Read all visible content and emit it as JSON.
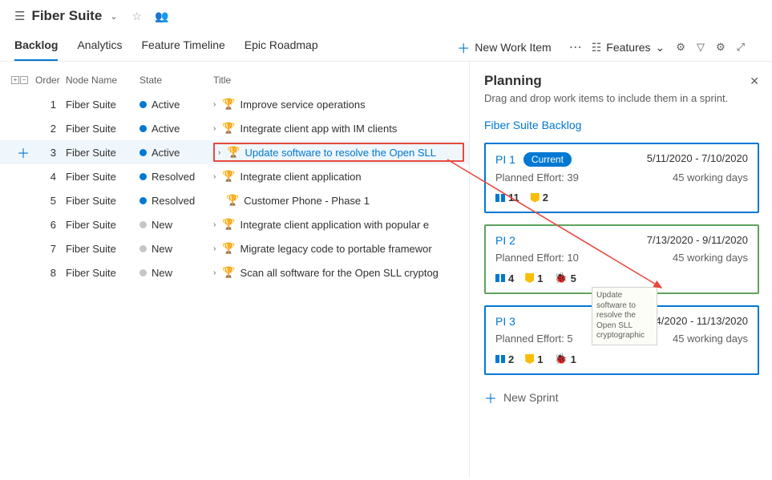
{
  "header": {
    "title": "Fiber Suite"
  },
  "tabs": [
    "Backlog",
    "Analytics",
    "Feature Timeline",
    "Epic Roadmap"
  ],
  "activeTab": 0,
  "newWorkItem": "New Work Item",
  "viewSelector": "Features",
  "grid": {
    "headers": {
      "order": "Order",
      "node": "Node Name",
      "state": "State",
      "title": "Title"
    },
    "rows": [
      {
        "order": "1",
        "node": "Fiber Suite",
        "state": "Active",
        "stateClass": "st-active",
        "title": "Improve service operations"
      },
      {
        "order": "2",
        "node": "Fiber Suite",
        "state": "Active",
        "stateClass": "st-active",
        "title": "Integrate client app with IM clients"
      },
      {
        "order": "3",
        "node": "Fiber Suite",
        "state": "Active",
        "stateClass": "st-active",
        "title": "Update software to resolve the Open SLL",
        "selected": true,
        "boxed": true
      },
      {
        "order": "4",
        "node": "Fiber Suite",
        "state": "Resolved",
        "stateClass": "st-resolved",
        "title": "Integrate client application"
      },
      {
        "order": "5",
        "node": "Fiber Suite",
        "state": "Resolved",
        "stateClass": "st-resolved",
        "title": "Customer Phone - Phase 1",
        "noChevron": true
      },
      {
        "order": "6",
        "node": "Fiber Suite",
        "state": "New",
        "stateClass": "st-new",
        "title": "Integrate client application with popular e"
      },
      {
        "order": "7",
        "node": "Fiber Suite",
        "state": "New",
        "stateClass": "st-new",
        "title": "Migrate legacy code to portable framewor"
      },
      {
        "order": "8",
        "node": "Fiber Suite",
        "state": "New",
        "stateClass": "st-new",
        "title": "Scan all software for the Open SLL cryptog"
      }
    ]
  },
  "panel": {
    "title": "Planning",
    "subtitle": "Drag and drop work items to include them in a sprint.",
    "backlogLink": "Fiber Suite Backlog",
    "sprints": [
      {
        "name": "PI 1",
        "current": true,
        "dates": "5/11/2020 - 7/10/2020",
        "effort": "Planned Effort: 39",
        "days": "45 working days",
        "counts": [
          {
            "icon": "book",
            "n": "11"
          },
          {
            "icon": "badge",
            "n": "2"
          }
        ]
      },
      {
        "name": "PI 2",
        "dates": "7/13/2020 - 9/11/2020",
        "effort": "Planned Effort: 10",
        "days": "45 working days",
        "green": true,
        "counts": [
          {
            "icon": "book",
            "n": "4"
          },
          {
            "icon": "badge",
            "n": "1"
          },
          {
            "icon": "bug",
            "n": "5"
          }
        ]
      },
      {
        "name": "PI 3",
        "dates": "9/14/2020 - 11/13/2020",
        "effort": "Planned Effort: 5",
        "days": "45 working days",
        "counts": [
          {
            "icon": "book",
            "n": "2"
          },
          {
            "icon": "badge",
            "n": "1"
          },
          {
            "icon": "bug",
            "n": "1"
          }
        ]
      }
    ],
    "newSprint": "New Sprint",
    "dragGhost": "Update software to resolve the Open SLL cryptographic"
  }
}
